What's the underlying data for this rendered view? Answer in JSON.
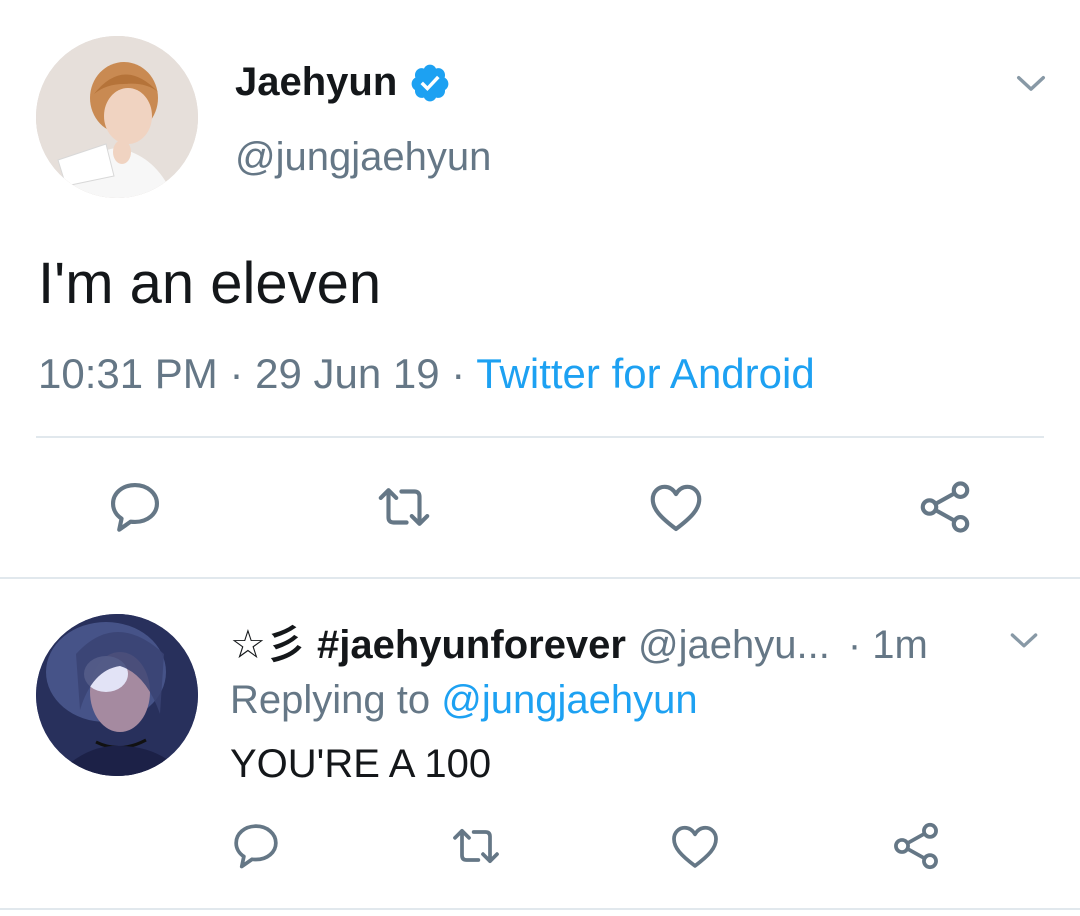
{
  "tweet": {
    "display_name": "Jaehyun",
    "handle": "@jungjaehyun",
    "text": "I'm an eleven",
    "time": "10:31 PM",
    "separator": "·",
    "date": "29 Jun 19",
    "source": "Twitter for Android",
    "verified": true
  },
  "reply": {
    "display_name": "☆彡 #jaehyunforever",
    "handle": "@jaehyu...",
    "time": "· 1m",
    "replying_prefix": "Replying to",
    "replying_to": "@jungjaehyun",
    "text": "YOU'RE A 100"
  },
  "icons": {
    "verified": "verified-badge-icon",
    "caret": "chevron-down-icon",
    "reply": "reply-icon",
    "retweet": "retweet-icon",
    "like": "heart-icon",
    "share": "share-icon"
  },
  "colors": {
    "accent": "#1da1f2",
    "secondary_text": "#657786",
    "primary_text": "#14171a",
    "divider": "#e1e8ed"
  }
}
